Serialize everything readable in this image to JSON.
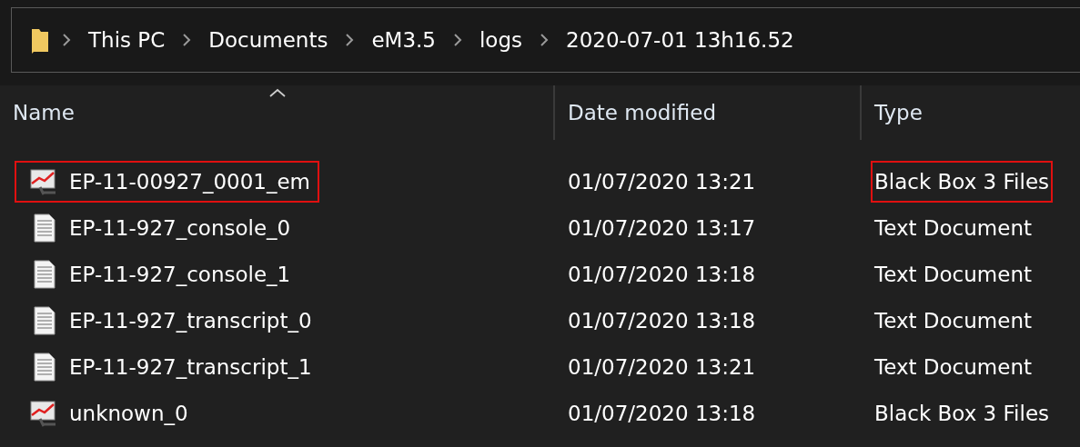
{
  "breadcrumb": [
    "This PC",
    "Documents",
    "eM3.5",
    "logs",
    "2020-07-01 13h16.52"
  ],
  "columns": [
    {
      "label": "Name",
      "sorted": true
    },
    {
      "label": "Date modified",
      "sorted": false
    },
    {
      "label": "Type",
      "sorted": false
    }
  ],
  "rows": [
    {
      "kind": "chart",
      "name": "EP-11-00927_0001_em",
      "date": "01/07/2020 13:21",
      "type": "Black Box 3 Files",
      "name_highlighted": true,
      "type_highlighted": true
    },
    {
      "kind": "text",
      "name": "EP-11-927_console_0",
      "date": "01/07/2020 13:17",
      "type": "Text Document",
      "name_highlighted": false,
      "type_highlighted": false
    },
    {
      "kind": "text",
      "name": "EP-11-927_console_1",
      "date": "01/07/2020 13:18",
      "type": "Text Document",
      "name_highlighted": false,
      "type_highlighted": false
    },
    {
      "kind": "text",
      "name": "EP-11-927_transcript_0",
      "date": "01/07/2020 13:18",
      "type": "Text Document",
      "name_highlighted": false,
      "type_highlighted": false
    },
    {
      "kind": "text",
      "name": "EP-11-927_transcript_1",
      "date": "01/07/2020 13:21",
      "type": "Text Document",
      "name_highlighted": false,
      "type_highlighted": false
    },
    {
      "kind": "chart",
      "name": "unknown_0",
      "date": "01/07/2020 13:18",
      "type": "Black Box 3 Files",
      "name_highlighted": false,
      "type_highlighted": false
    }
  ]
}
